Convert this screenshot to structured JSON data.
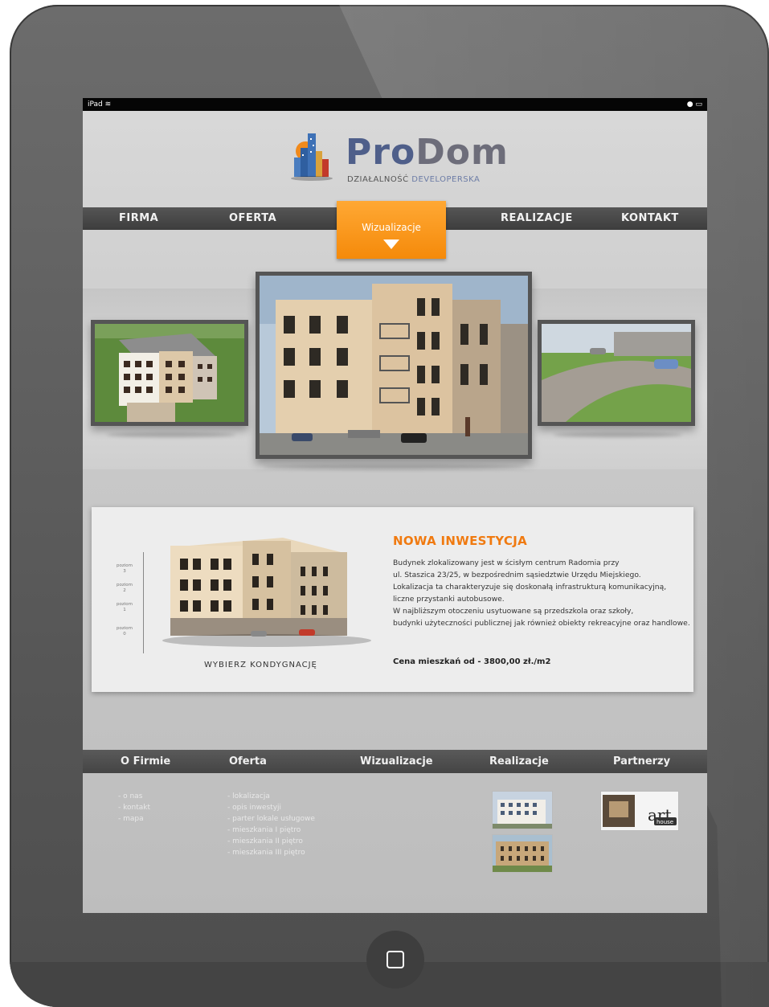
{
  "status_bar": {
    "device": "iPad",
    "wifi_icon": "wifi-icon",
    "battery_icon": "battery-icon"
  },
  "logo": {
    "name_part1": "Pro",
    "name_part2": "Dom",
    "tagline_highlight": "DZIAŁALNOŚĆ",
    "tagline_rest": " DEVELOPERSKA"
  },
  "main_nav": {
    "items": [
      "FIRMA",
      "OFERTA",
      "REALIZACJE",
      "KONTAKT"
    ],
    "active": "Wizualizacje"
  },
  "investment": {
    "title": "NOWA INWESTYCJA",
    "lines": [
      "Budynek zlokalizowany jest w ścisłym centrum Radomia przy",
      "ul. Staszica 23/25, w bezpośrednim sąsiedztwie Urzędu Miejskiego.",
      "Lokalizacja ta charakteryzuje się doskonałą infrastrukturą komunikacyjną,",
      "liczne przystanki autobusowe.",
      "W najbliższym otoczeniu usytuowane są przedszkola oraz szkoły,",
      "budynki użyteczności publicznej jak również obiekty rekreacyjne oraz handlowe."
    ],
    "price": "Cena mieszkań od - 3800,00 zł./m2",
    "choose_floor": "WYBIERZ KONDYGNACJĘ",
    "floors": [
      {
        "label": "poziom",
        "num": "3"
      },
      {
        "label": "poziom",
        "num": "2"
      },
      {
        "label": "poziom",
        "num": "1"
      },
      {
        "label": "poziom",
        "num": "0"
      }
    ]
  },
  "footer_nav": {
    "items": [
      "O Firmie",
      "Oferta",
      "Wizualizacje",
      "Realizacje",
      "Partnerzy"
    ]
  },
  "footer_links": {
    "firma": [
      "- o nas",
      "- kontakt",
      "- mapa"
    ],
    "oferta": [
      "- lokalizacja",
      "- opis inwestyji",
      "- parter lokale usługowe",
      "- mieszkania I piętro",
      "- mieszkania II piętro",
      "- mieszkania III piętro"
    ]
  },
  "partner_logo": "house",
  "colors": {
    "accent": "#f58a0a",
    "nav_bg": "#444444",
    "title_orange": "#f07a10"
  }
}
